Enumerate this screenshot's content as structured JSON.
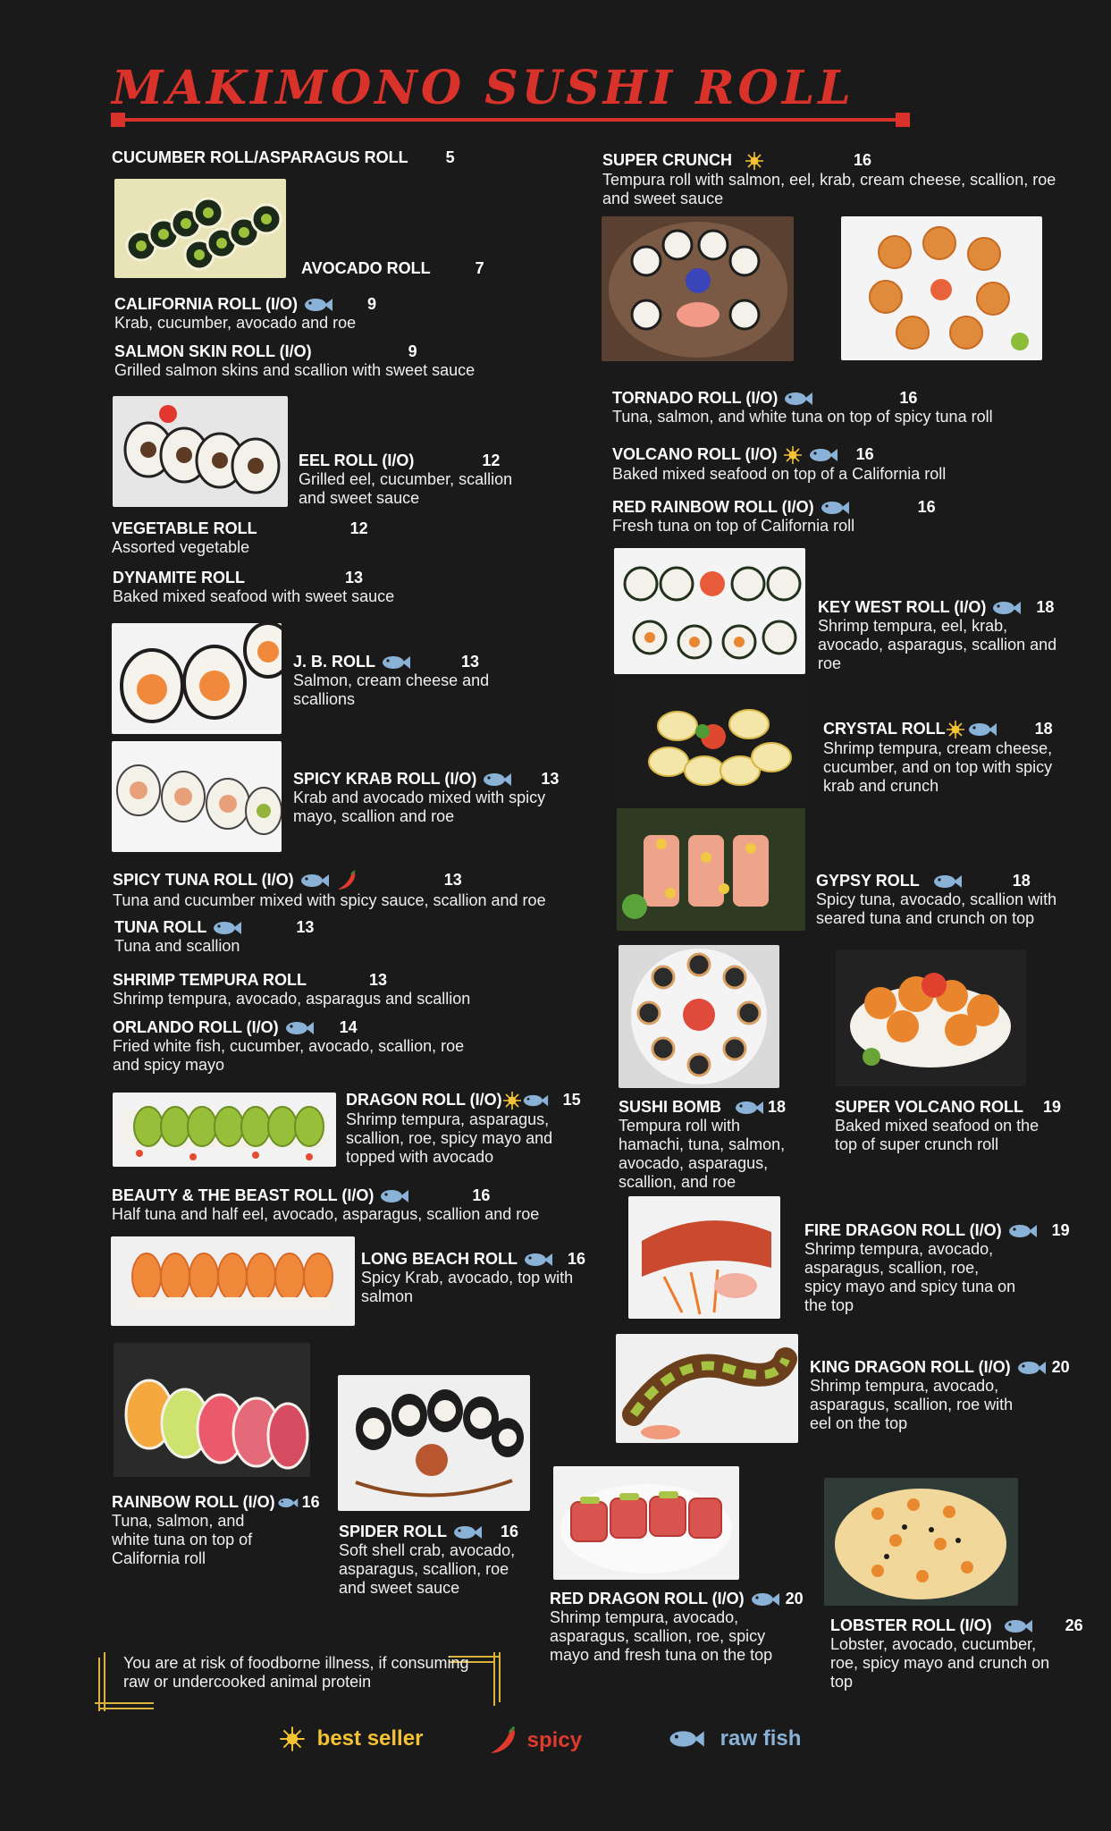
{
  "title": "MAKIMONO SUSHI ROLL",
  "colors": {
    "accent": "#d9322b",
    "best_seller": "#f4c233",
    "spicy": "#e03a2f",
    "raw_fish": "#8ab1d6",
    "background": "#1a1a1a"
  },
  "legend": {
    "best_seller": "best seller",
    "spicy": "spicy",
    "raw_fish": "raw fish"
  },
  "notice": "You are at risk of foodborne illness, if consuming raw or undercooked animal protein",
  "left_items": [
    {
      "name": "CUCUMBER ROLL/ASPARAGUS ROLL",
      "price": "5",
      "desc": "",
      "icons": []
    },
    {
      "name": "AVOCADO ROLL",
      "price": "7",
      "desc": "",
      "icons": []
    },
    {
      "name": "CALIFORNIA ROLL (I/O)",
      "price": "9",
      "desc": "Krab, cucumber, avocado and roe",
      "icons": [
        "raw-fish-icon"
      ]
    },
    {
      "name": "SALMON SKIN ROLL (I/O)",
      "price": "9",
      "desc": "Grilled salmon skins and scallion with sweet sauce",
      "icons": []
    },
    {
      "name": "EEL ROLL (I/O)",
      "price": "12",
      "desc": "Grilled eel, cucumber, scallion and sweet sauce",
      "icons": []
    },
    {
      "name": "VEGETABLE ROLL",
      "price": "12",
      "desc": "Assorted vegetable",
      "icons": []
    },
    {
      "name": "DYNAMITE ROLL",
      "price": "13",
      "desc": "Baked mixed seafood with sweet sauce",
      "icons": []
    },
    {
      "name": "J. B. ROLL",
      "price": "13",
      "desc": "Salmon, cream cheese and scallions",
      "icons": [
        "raw-fish-icon"
      ]
    },
    {
      "name": "SPICY KRAB ROLL (I/O)",
      "price": "13",
      "desc": "Krab and avocado mixed with spicy mayo, scallion and roe",
      "icons": [
        "raw-fish-icon"
      ]
    },
    {
      "name": "SPICY TUNA ROLL (I/O)",
      "price": "13",
      "desc": "Tuna and cucumber mixed with spicy sauce, scallion and roe",
      "icons": [
        "raw-fish-icon",
        "spicy-icon"
      ]
    },
    {
      "name": "TUNA ROLL",
      "price": "13",
      "desc": "Tuna and scallion",
      "icons": [
        "raw-fish-icon"
      ]
    },
    {
      "name": "SHRIMP TEMPURA ROLL",
      "price": "13",
      "desc": "Shrimp tempura, avocado, asparagus and scallion",
      "icons": []
    },
    {
      "name": "ORLANDO ROLL (I/O)",
      "price": "14",
      "desc": "Fried white fish, cucumber, avocado, scallion, roe and spicy mayo",
      "icons": [
        "raw-fish-icon"
      ]
    },
    {
      "name": "DRAGON ROLL (I/O)",
      "price": "15",
      "desc": "Shrimp tempura, asparagus, scallion, roe, spicy mayo and topped with avocado",
      "icons": [
        "best-seller-icon",
        "raw-fish-icon"
      ]
    },
    {
      "name": "BEAUTY & THE BEAST ROLL (I/O)",
      "price": "16",
      "desc": "Half tuna and half eel, avocado, asparagus, scallion and roe",
      "icons": [
        "raw-fish-icon"
      ]
    },
    {
      "name": "LONG BEACH ROLL",
      "price": "16",
      "desc": "Spicy Krab, avocado, top with salmon",
      "icons": [
        "raw-fish-icon"
      ]
    },
    {
      "name": "RAINBOW ROLL (I/O)",
      "price": "16",
      "desc": "Tuna, salmon, and white tuna on top of California roll",
      "icons": [
        "raw-fish-icon"
      ]
    },
    {
      "name": "SPIDER ROLL",
      "price": "16",
      "desc": "Soft shell crab, avocado, asparagus, scallion, roe and sweet sauce",
      "icons": [
        "raw-fish-icon"
      ]
    }
  ],
  "right_items": [
    {
      "name": "SUPER CRUNCH",
      "price": "16",
      "desc": "Tempura roll with salmon, eel, krab, cream cheese, scallion, roe and sweet sauce",
      "icons": [
        "best-seller-icon"
      ]
    },
    {
      "name": "TORNADO ROLL (I/O)",
      "price": "16",
      "desc": "Tuna, salmon, and white tuna on top of spicy tuna roll",
      "icons": [
        "raw-fish-icon"
      ]
    },
    {
      "name": "VOLCANO ROLL (I/O)",
      "price": "16",
      "desc": "Baked mixed seafood on top of a California roll",
      "icons": [
        "best-seller-icon",
        "raw-fish-icon"
      ]
    },
    {
      "name": "RED RAINBOW ROLL (I/O)",
      "price": "16",
      "desc": "Fresh tuna on top of California roll",
      "icons": [
        "raw-fish-icon"
      ]
    },
    {
      "name": "KEY WEST ROLL (I/O)",
      "price": "18",
      "desc": "Shrimp tempura, eel, krab, avocado, asparagus, scallion and roe",
      "icons": [
        "raw-fish-icon"
      ]
    },
    {
      "name": "CRYSTAL ROLL",
      "price": "18",
      "desc": "Shrimp tempura, cream cheese, cucumber, and on top with spicy krab and crunch",
      "icons": [
        "best-seller-icon",
        "raw-fish-icon"
      ]
    },
    {
      "name": "GYPSY ROLL",
      "price": "18",
      "desc": "Spicy tuna, avocado, scallion with seared tuna and crunch on top",
      "icons": [
        "raw-fish-icon"
      ]
    },
    {
      "name": "SUSHI BOMB",
      "price": "18",
      "desc": "Tempura roll with hamachi, tuna, salmon, avocado, asparagus, scallion, and roe",
      "icons": [
        "raw-fish-icon"
      ]
    },
    {
      "name": "SUPER VOLCANO ROLL",
      "price": "19",
      "desc": "Baked mixed seafood on the top of super crunch roll",
      "icons": []
    },
    {
      "name": "FIRE DRAGON ROLL (I/O)",
      "price": "19",
      "desc": "Shrimp tempura, avocado, asparagus, scallion, roe, spicy mayo and spicy tuna on the top",
      "icons": [
        "raw-fish-icon"
      ]
    },
    {
      "name": "KING DRAGON ROLL (I/O)",
      "price": "20",
      "desc": "Shrimp tempura, avocado, asparagus, scallion, roe with eel on the top",
      "icons": [
        "raw-fish-icon"
      ]
    },
    {
      "name": "RED DRAGON ROLL (I/O)",
      "price": "20",
      "desc": "Shrimp tempura, avocado, asparagus, scallion, roe, spicy mayo and fresh tuna on the top",
      "icons": [
        "raw-fish-icon"
      ]
    },
    {
      "name": "LOBSTER ROLL (I/O)",
      "price": "26",
      "desc": "Lobster, avocado, cucumber, roe, spicy mayo and crunch on top",
      "icons": [
        "raw-fish-icon"
      ]
    }
  ]
}
